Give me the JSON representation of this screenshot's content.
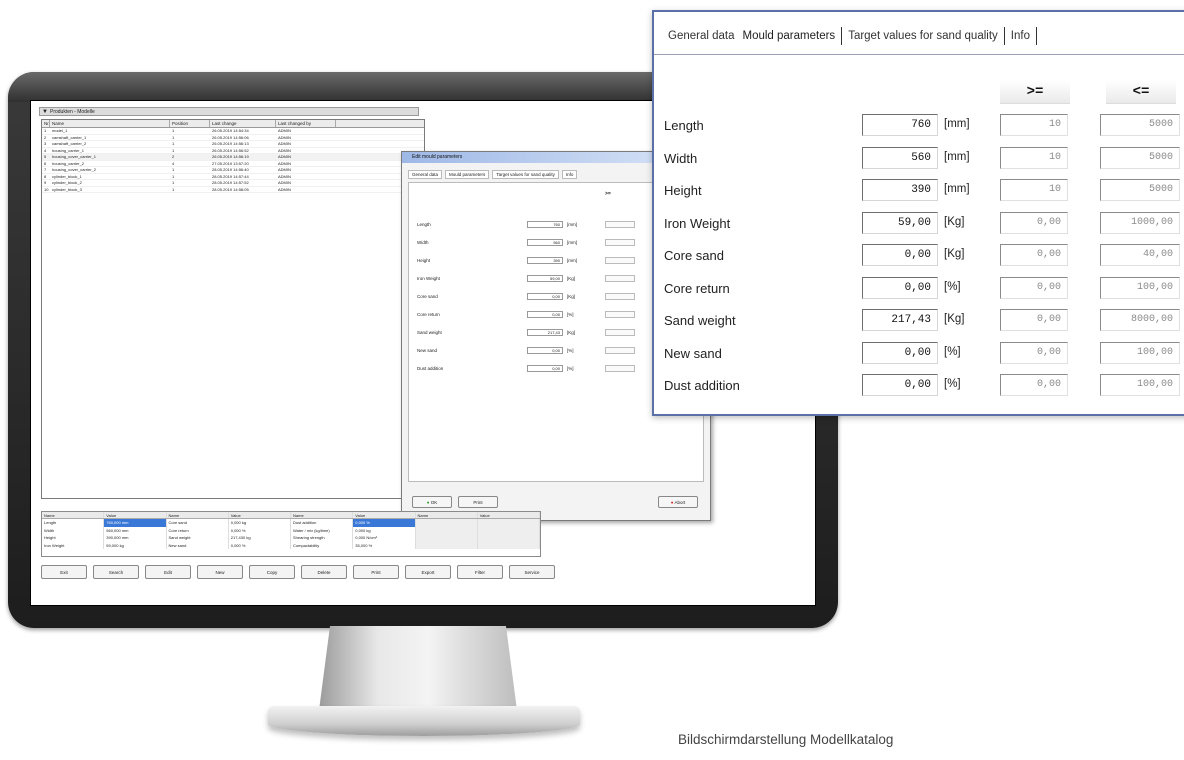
{
  "screen": {
    "window_title": "Produkten - Modelle",
    "grid_headers": [
      "Nr.",
      "Name",
      "Position",
      "Last change",
      "Last changed by"
    ],
    "grid_rows": [
      [
        "1",
        "model_1",
        "1",
        "26.05.2019 14:54:34",
        "ADMIN"
      ],
      [
        "2",
        "camshaft_carrier_1",
        "1",
        "26.05.2019 14:56:06",
        "ADMIN"
      ],
      [
        "3",
        "camshaft_carrier_2",
        "1",
        "26.05.2019 14:56:13",
        "ADMIN"
      ],
      [
        "4",
        "housing_carrier_1",
        "1",
        "26.05.2019 14:56:52",
        "ADMIN"
      ],
      [
        "5",
        "housing_cover_carrier_1",
        "2",
        "26.05.2019 14:56:19",
        "ADMIN"
      ],
      [
        "6",
        "housing_carrier_2",
        "4",
        "27.05.2019 13:57:20",
        "ADMIN"
      ],
      [
        "7",
        "housing_cover_carrier_2",
        "1",
        "28.05.2019 14:56:40",
        "ADMIN"
      ],
      [
        "8",
        "cylinder_block_1",
        "1",
        "28.05.2019 14:57:44",
        "ADMIN"
      ],
      [
        "9",
        "cylinder_block_2",
        "1",
        "28.05.2019 14:57:52",
        "ADMIN"
      ],
      [
        "10",
        "cylinder_block_3",
        "1",
        "28.05.2019 14:58:05",
        "ADMIN"
      ]
    ],
    "dialog_title": "Edit mould parameters",
    "dialog_tabs": [
      "General data",
      "Mould parameters",
      "Target values for sand quality",
      "Info"
    ],
    "dialog_compare_labels": [
      ">="
    ],
    "dialog_rows": [
      {
        "label": "Length",
        "value": "760",
        "unit": "[mm]"
      },
      {
        "label": "Width",
        "value": "560",
        "unit": "[mm]"
      },
      {
        "label": "Height",
        "value": "390",
        "unit": "[mm]"
      },
      {
        "label": "Iron Weight",
        "value": "59,00",
        "unit": "[Kg]"
      },
      {
        "label": "Core sand",
        "value": "0,00",
        "unit": "[Kg]"
      },
      {
        "label": "Core return",
        "value": "0,00",
        "unit": "[%]"
      },
      {
        "label": "Sand weight",
        "value": "217,43",
        "unit": "[Kg]"
      },
      {
        "label": "New sand",
        "value": "0,00",
        "unit": "[%]"
      },
      {
        "label": "Dust addition",
        "value": "0,00",
        "unit": "[%]"
      }
    ],
    "dialog_buttons": {
      "ok": "OK",
      "print": "Print",
      "abort": "Abort"
    },
    "bottom_headers": [
      "Name",
      "Value",
      "Name",
      "Value",
      "Name",
      "Value",
      "Name",
      "Value"
    ],
    "bottom_rows": [
      [
        "Length",
        "760,000 mm",
        "Core sand",
        "0,000 kg",
        "Dust addition",
        "0,000 %",
        "",
        ""
      ],
      [
        "Width",
        "560,000 mm",
        "Core return",
        "0,000 %",
        "Water / mix (kg/time)",
        "0,000 kg",
        "",
        ""
      ],
      [
        "Height",
        "390,000 mm",
        "Sand weight",
        "217,430 kg",
        "Shearing strength",
        "0,000 N/cm²",
        "",
        ""
      ],
      [
        "Iron Weight",
        "59,000 kg",
        "New sand",
        "0,000 %",
        "Compactability",
        "35,000 %",
        "",
        ""
      ]
    ],
    "toolbar_buttons": [
      "Exit",
      "Search",
      "Edit",
      "New",
      "Copy",
      "Delete",
      "Print",
      "Export",
      "Filter",
      "Service"
    ]
  },
  "zoom_dialog": {
    "tabs": [
      {
        "label": "General data",
        "active": false
      },
      {
        "label": "Mould parameters",
        "active": true
      },
      {
        "label": "Target values for sand quality",
        "active": false
      },
      {
        "label": "Info",
        "active": false
      }
    ],
    "col_min_label": ">=",
    "col_max_label": "<=",
    "rows": [
      {
        "label": "Length",
        "value": "760",
        "unit": "[mm]",
        "min": "10",
        "max": "5000"
      },
      {
        "label": "Width",
        "value": "560",
        "unit": "[mm]",
        "min": "10",
        "max": "5000"
      },
      {
        "label": "Height",
        "value": "390",
        "unit": "[mm]",
        "min": "10",
        "max": "5000"
      },
      {
        "label": "Iron Weight",
        "value": "59,00",
        "unit": "[Kg]",
        "min": "0,00",
        "max": "1000,00"
      },
      {
        "label": "Core sand",
        "value": "0,00",
        "unit": "[Kg]",
        "min": "0,00",
        "max": "40,00"
      },
      {
        "label": "Core return",
        "value": "0,00",
        "unit": "[%]",
        "min": "0,00",
        "max": "100,00"
      },
      {
        "label": "Sand weight",
        "value": "217,43",
        "unit": "[Kg]",
        "min": "0,00",
        "max": "8000,00"
      },
      {
        "label": "New sand",
        "value": "0,00",
        "unit": "[%]",
        "min": "0,00",
        "max": "100,00"
      },
      {
        "label": "Dust addition",
        "value": "0,00",
        "unit": "[%]",
        "min": "0,00",
        "max": "100,00"
      }
    ]
  },
  "caption": "Bildschirmdarstellung Modellkatalog",
  "colors": {
    "dialog_border": "#5b6fa8",
    "selection": "#3a78d8",
    "monitor_frame": "#2a2a2a"
  },
  "icons": [
    "window-icon"
  ]
}
